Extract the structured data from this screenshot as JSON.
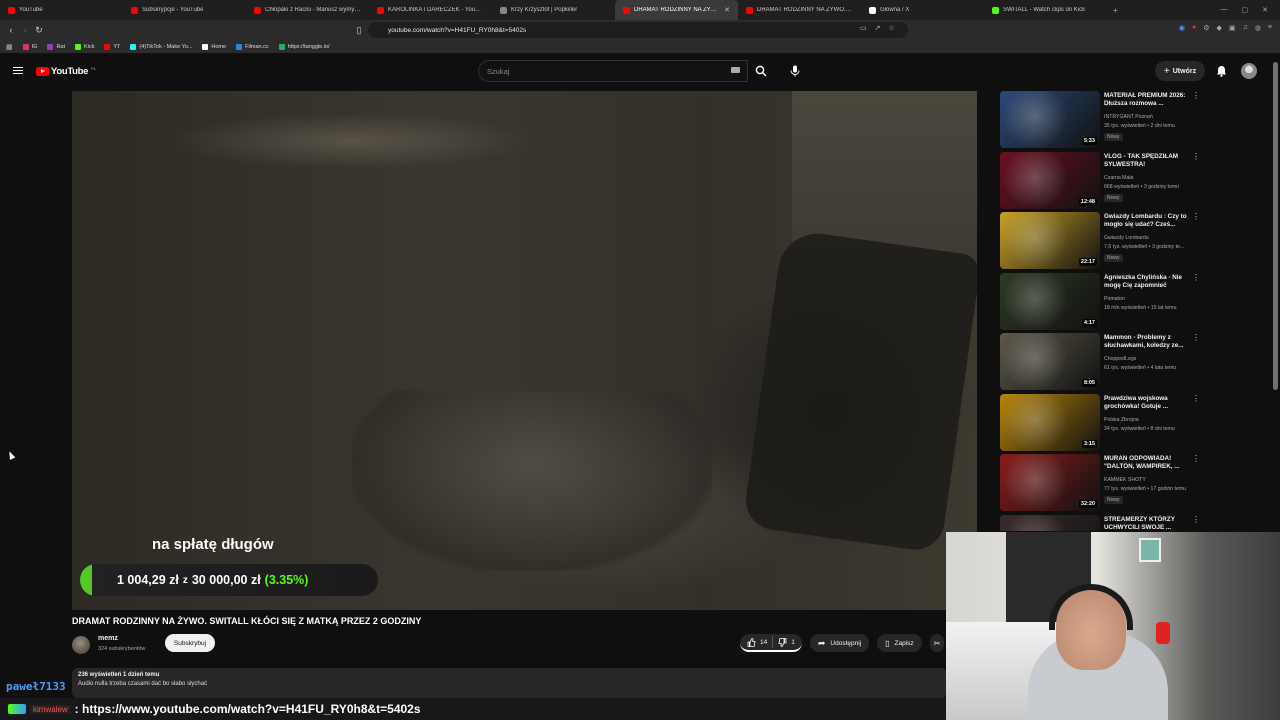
{
  "browser": {
    "tabs": [
      {
        "title": "YouTube",
        "color": "#ff0000"
      },
      {
        "title": "Subskrypcje - YouTube",
        "color": "#ff0000"
      },
      {
        "title": "Chłopaki z Racisi - Mariusz wymyślił...",
        "color": "#ff0000"
      },
      {
        "title": "KAROLINKA I DARECZEK - YouTube",
        "color": "#ff0000"
      },
      {
        "title": "Krzy Krzysztof | Popkiller",
        "color": "#888888"
      },
      {
        "title": "DRAMAT RODZINNY NA ŻYWO...",
        "color": "#ff0000",
        "active": true
      },
      {
        "title": "DRAMAT RODZINNY NA ŻYWO. SWI...",
        "color": "#ff0000"
      },
      {
        "title": "Główna / X",
        "color": "#ffffff"
      },
      {
        "title": "SWITALL - Watch clips on Kick",
        "color": "#53fc18"
      }
    ],
    "url": "youtube.com/watch?v=H41FU_RY0h8&t=5402s",
    "bookmarks": [
      {
        "label": "IG",
        "color": "#e1306c"
      },
      {
        "label": "Rat",
        "color": "#8e44ad"
      },
      {
        "label": "Kick",
        "color": "#53fc18"
      },
      {
        "label": "YT",
        "color": "#ff0000"
      },
      {
        "label": "(4)TikTok - Make Yo...",
        "color": "#25f4ee"
      },
      {
        "label": "Home",
        "color": "#ffffff"
      },
      {
        "label": "Filman.cc",
        "color": "#2e86de"
      },
      {
        "label": "https://tanggle.io/",
        "color": "#27ae60"
      }
    ]
  },
  "youtube": {
    "logo_text": "YouTube",
    "logo_region": "PL",
    "search_placeholder": "Szukaj",
    "create_label": "Utwórz"
  },
  "player": {
    "overlay_title": "na spłatę długów",
    "donation_current": "1 004,29 zł",
    "donation_sep": "z",
    "donation_goal": "30 000,00 zł",
    "donation_percent": "(3.35%)",
    "donation_fraction": 0.0335
  },
  "video": {
    "title": "DRAMAT RODZINNY NA ŻYWO. SWITALL KŁÓCI SIĘ Z MATKĄ PRZEZ 2 GODZINY",
    "channel": "memz",
    "subscribers": "324 subskrybentów",
    "subscribe_label": "Subskrybuj",
    "likes": "14",
    "dislikes": "1",
    "share_label": "Udostępnij",
    "save_label": "Zapisz",
    "views_date": "236 wyświetleń  1 dzień temu",
    "description": "Audio nulla trzeba czasami dać bo słabo słychać"
  },
  "recommendations": [
    {
      "title": "MATERIAŁ PREMIUM 2026: Dłuższa rozmowa ...",
      "channel": "INTRYGANT Poznań",
      "meta": "35 tys. wyświetleń • 2 dni temu",
      "duration": "5:33",
      "new": "Nowy",
      "thumb": "#2c4a7a"
    },
    {
      "title": "VLOG - TAK SPĘDZIŁAM SYLWESTRA!",
      "channel": "Czarna Mała",
      "meta": "668 wyświetleń • 3 godziny temu",
      "duration": "12:48",
      "new": "Nowy",
      "thumb": "#6b1022"
    },
    {
      "title": "Gwiazdy Lombardu : Czy to mogło się udać? Cześ...",
      "channel": "Gwiazdy Lombardu",
      "meta": "7,6 tys. wyświetleń • 3 godziny te...",
      "duration": "22:17",
      "new": "Nowy",
      "thumb": "#c9a227"
    },
    {
      "title": "Agnieszka Chylińska - Nie mogę Cię zapomnieć",
      "channel": "Pomaton",
      "meta": "18 mln wyświetleń • 15 lat temu",
      "duration": "4:17",
      "new": "",
      "thumb": "#2f3a24"
    },
    {
      "title": "Mammon - Problemy z słuchawkami, koledzy ze...",
      "channel": "ChoppedLegs",
      "meta": "61 tys. wyświetleń • 4 lata temu",
      "duration": "8:05",
      "new": "",
      "thumb": "#5d5a4a"
    },
    {
      "title": "Prawdziwa wojskowa grochówka! Gotuje ...",
      "channel": "Polska Zbrojna",
      "meta": "34 tys. wyświetleń • 8 dni temu",
      "duration": "3:15",
      "new": "",
      "thumb": "#b8860b"
    },
    {
      "title": "MURAN ODPOWIADA! \"DALTON, WAMPIREK, ...",
      "channel": "KAMMEK SHOTY",
      "meta": "77 tys. wyświetleń • 17 godzin temu",
      "duration": "32:20",
      "new": "Nowy",
      "thumb": "#8a1c1c"
    },
    {
      "title": "STREAMERZY KTÓRZY UCHWYCILI SWOJE ...",
      "channel": "",
      "meta": "",
      "duration": "",
      "new": "",
      "thumb": "#3b2a2a"
    }
  ],
  "stream_overlay": {
    "chat_username": "paweł7133",
    "chat_user_tag": "kimwalew",
    "chat_message": ": https://www.youtube.com/watch?v=H41FU_RY0h8&t=5402s"
  },
  "icons": [
    "back-icon",
    "forward-icon",
    "reload-icon",
    "bookmark-icon",
    "menu-icon",
    "search-icon",
    "mic-icon",
    "bell-icon",
    "like-icon",
    "dislike-icon",
    "share-icon",
    "save-icon",
    "more-icon"
  ]
}
